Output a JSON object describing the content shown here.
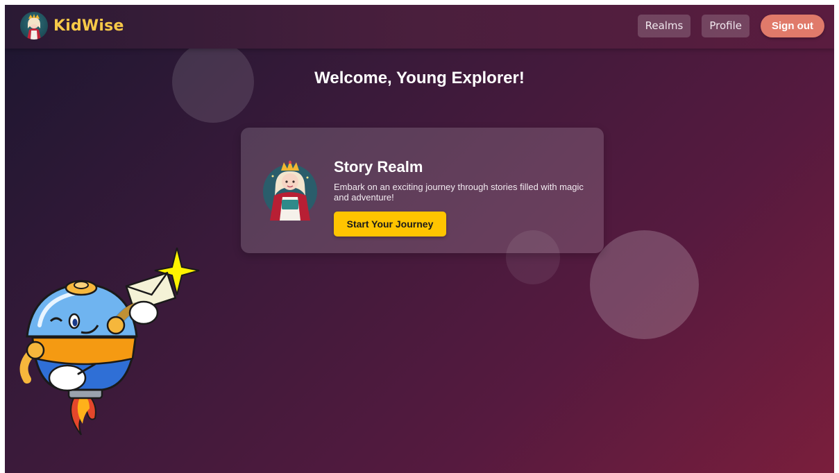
{
  "brand": {
    "name": "KidWise",
    "logo_icon": "princess-logo-icon"
  },
  "nav": {
    "realms": "Realms",
    "profile": "Profile",
    "signout": "Sign out"
  },
  "main": {
    "welcome": "Welcome, Young Explorer!"
  },
  "card": {
    "title": "Story Realm",
    "description": "Embark on an exciting journey through stories filled with magic and adventure!",
    "button": "Start Your Journey",
    "avatar_icon": "princess-avatar-icon"
  },
  "mascot": {
    "icon": "robot-mascot-icon"
  },
  "colors": {
    "brand": "#f7c948",
    "signout": "#e07a6a",
    "cta": "#ffc400",
    "bg_start": "#1c1630",
    "bg_end": "#7a1e3c"
  }
}
